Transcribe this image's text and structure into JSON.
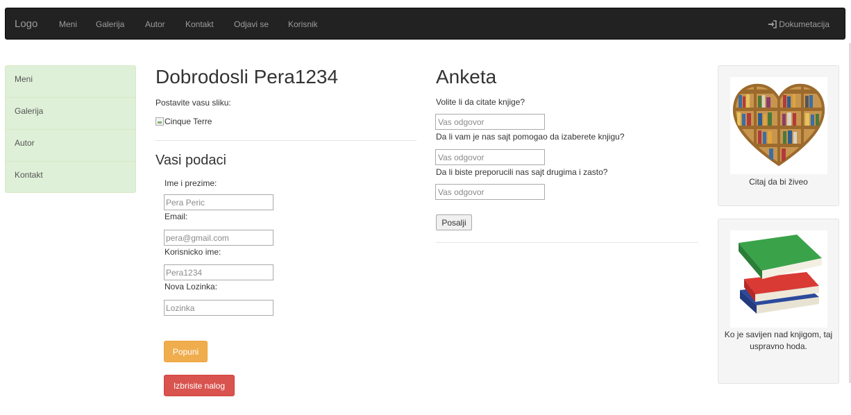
{
  "navbar": {
    "logo": "Logo",
    "links": [
      "Meni",
      "Galerija",
      "Autor",
      "Kontakt",
      "Odjavi se",
      "Korisnik"
    ],
    "doc_link": "Dokumetacija",
    "doc_icon": "sign-in-icon"
  },
  "sidebar": {
    "items": [
      "Meni",
      "Galerija",
      "Autor",
      "Kontakt"
    ]
  },
  "profile": {
    "welcome": "Dobrodosli Pera1234",
    "photo_label": "Postavite vasu sliku:",
    "photo_alt": "Cinque Terre",
    "section_title": "Vasi podaci",
    "fields": [
      {
        "label": "Ime i prezime:",
        "placeholder": "Pera Peric"
      },
      {
        "label": "Email:",
        "placeholder": "pera@gmail.com"
      },
      {
        "label": "Korisnicko ime:",
        "placeholder": "Pera1234"
      },
      {
        "label": "Nova Lozinka:",
        "placeholder": "Lozinka"
      }
    ],
    "fill_button": "Popuni",
    "delete_button": "Izbrisite nalog"
  },
  "poll": {
    "title": "Anketa",
    "questions": [
      {
        "label": "Volite li da citate knjige?",
        "placeholder": "Vas odgovor"
      },
      {
        "label": "Da li vam je nas sajt pomogao da izaberete knjigu?",
        "placeholder": "Vas odgovor"
      },
      {
        "label": "Da li biste preporucili nas sajt drugima i zasto?",
        "placeholder": "Vas odgovor"
      }
    ],
    "submit_button": "Posalji"
  },
  "cards": [
    {
      "image": "heart-bookshelf-image",
      "caption": "Citaj da bi živeo"
    },
    {
      "image": "stacked-books-image",
      "caption": "Ko je savijen nad knjigom, taj uspravno hoda."
    }
  ],
  "colors": {
    "navbar_bg": "#222222",
    "sidebar_bg": "#dff0d8",
    "warning": "#f0ad4e",
    "danger": "#d9534f"
  }
}
